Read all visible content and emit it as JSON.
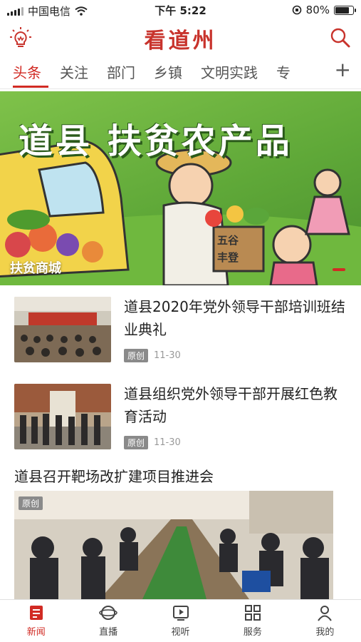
{
  "status_bar": {
    "carrier": "中国电信",
    "time": "下午 5:22",
    "battery": "80%",
    "battery_level": 0.8
  },
  "header": {
    "logo": "看道州",
    "bulb_icon": "lightbulb-icon",
    "search_icon": "search-icon"
  },
  "tabs": {
    "items": [
      {
        "label": "头条"
      },
      {
        "label": "关注"
      },
      {
        "label": "部门"
      },
      {
        "label": "乡镇"
      },
      {
        "label": "文明实践"
      },
      {
        "label": "专"
      }
    ],
    "add_label": "+"
  },
  "banner": {
    "title": "道县 扶贫农产品",
    "label": "扶贫商城",
    "crate_text": "五谷丰登"
  },
  "news": [
    {
      "title": "道县2020年党外领导干部培训班结业典礼",
      "badge": "原创",
      "date": "11-30"
    },
    {
      "title": "道县组织党外领导干部开展红色教育活动",
      "badge": "原创",
      "date": "11-30"
    }
  ],
  "featured": {
    "title": "道县召开靶场改扩建项目推进会",
    "badge": "原创"
  },
  "bottom_nav": [
    {
      "label": "新闻",
      "icon": "news-icon"
    },
    {
      "label": "直播",
      "icon": "live-icon"
    },
    {
      "label": "视听",
      "icon": "video-icon"
    },
    {
      "label": "服务",
      "icon": "grid-icon"
    },
    {
      "label": "我的",
      "icon": "user-icon"
    }
  ],
  "colors": {
    "accent": "#d12b24",
    "badge": "#8a8a8a"
  }
}
